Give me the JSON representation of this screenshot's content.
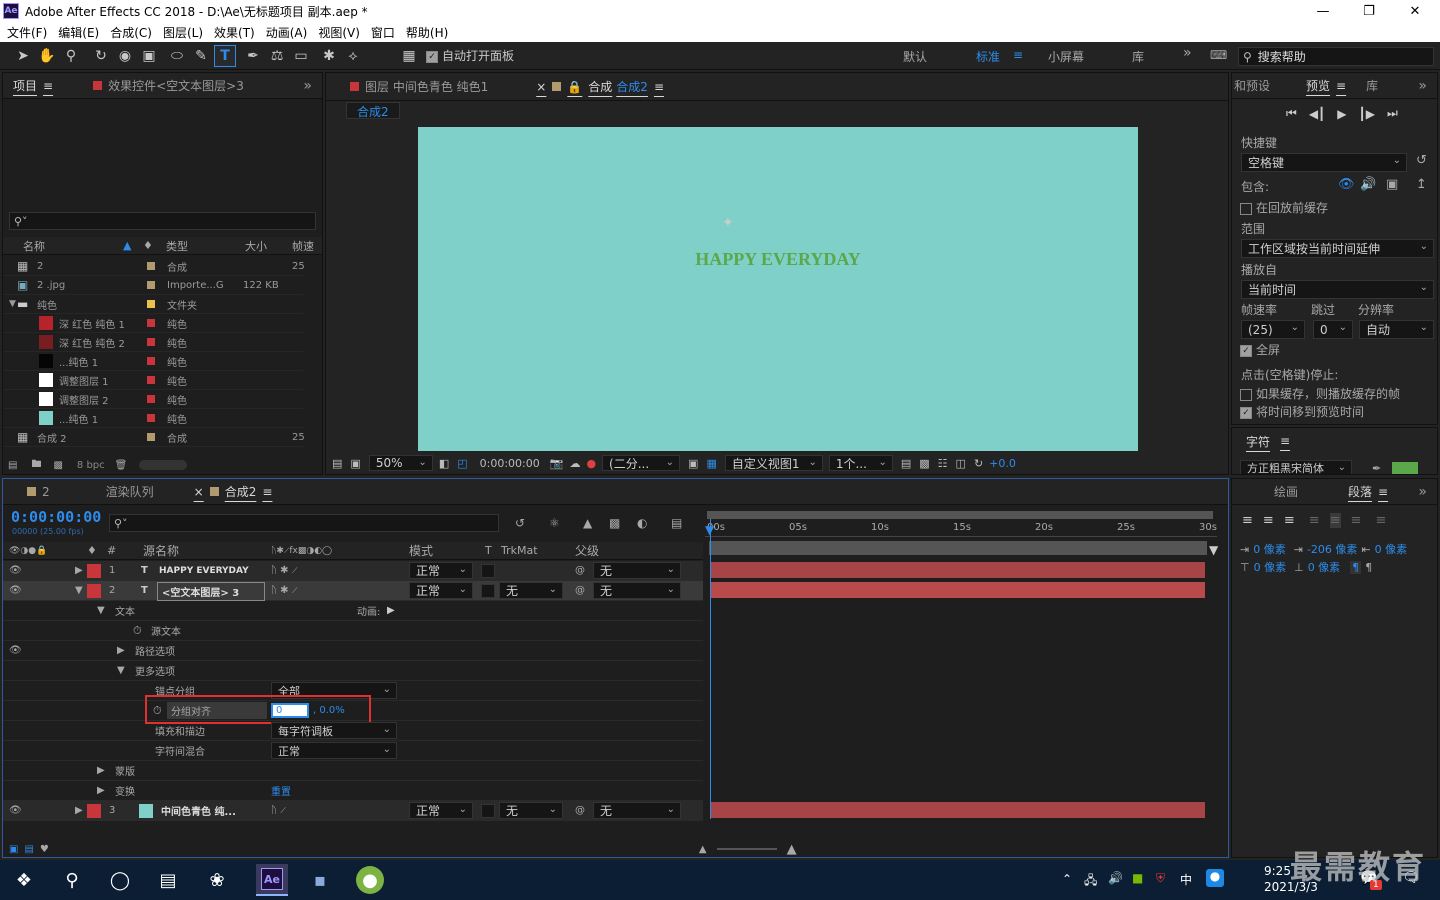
{
  "titlebar": {
    "title": "Adobe After Effects CC 2018 - D:\\Ae\\无标题项目 副本.aep *"
  },
  "menu": [
    "文件(F)",
    "编辑(E)",
    "合成(C)",
    "图层(L)",
    "效果(T)",
    "动画(A)",
    "视图(V)",
    "窗口",
    "帮助(H)"
  ],
  "toolbar": {
    "auto_open_label": "自动打开面板",
    "workspaces": [
      "默认",
      "标准",
      "小屏幕",
      "库"
    ],
    "active_workspace": "标准",
    "search_placeholder": "搜索帮助"
  },
  "project": {
    "tab_project": "项目",
    "tab_effects": "效果控件<空文本图层>3",
    "columns": {
      "name": "名称",
      "type": "类型",
      "size": "大小",
      "fps": "帧速"
    },
    "items": [
      {
        "name": "2",
        "type": "合成",
        "size": "",
        "fps": "25",
        "label_color": "#b09a6e",
        "swatch": "comp"
      },
      {
        "name": "2 .jpg",
        "type": "Importe...G",
        "size": "122 KB",
        "fps": "",
        "label_color": "#b09a6e",
        "swatch": "file"
      },
      {
        "name": "纯色",
        "type": "文件夹",
        "size": "",
        "fps": "",
        "label_color": "#e8c24a",
        "swatch": "folder"
      },
      {
        "name": "深 红色 纯色 1",
        "type": "纯色",
        "size": "",
        "fps": "",
        "label_color": "#c8363c",
        "swatch": "#b5232b"
      },
      {
        "name": "深 红色 纯色 2",
        "type": "纯色",
        "size": "",
        "fps": "",
        "label_color": "#c8363c",
        "swatch": "#7a1d22"
      },
      {
        "name": "...纯色 1",
        "type": "纯色",
        "size": "",
        "fps": "",
        "label_color": "#c8363c",
        "swatch": "#050505"
      },
      {
        "name": "调整图层 1",
        "type": "纯色",
        "size": "",
        "fps": "",
        "label_color": "#c8363c",
        "swatch": "#ffffff"
      },
      {
        "name": "调整图层 2",
        "type": "纯色",
        "size": "",
        "fps": "",
        "label_color": "#c8363c",
        "swatch": "#ffffff"
      },
      {
        "name": "...纯色 1",
        "type": "纯色",
        "size": "",
        "fps": "",
        "label_color": "#c8363c",
        "swatch": "#7ed0c8"
      },
      {
        "name": "合成 2",
        "type": "合成",
        "size": "",
        "fps": "25",
        "label_color": "#b09a6e",
        "swatch": "comp"
      }
    ],
    "bpc": "8 bpc"
  },
  "viewer": {
    "tab_layer": "图层 中间色青色 纯色1",
    "tab_comp": "合成",
    "tab_comp_name": "合成2",
    "breadcrumb": "合成2",
    "canvas_color": "#7ed0c8",
    "canvas_text": "HAPPY EVERYDAY",
    "canvas_text_color": "#5aa84a",
    "zoom": "50%",
    "timecode": "0:00:00:00",
    "resolution": "(二分...",
    "view": "自定义视图1",
    "views_count": "1个...",
    "exposure": "+0.0"
  },
  "preview": {
    "tab_presets": "和预设",
    "tab_preview": "预览",
    "tab_library": "库",
    "shortcut_label": "快捷键",
    "shortcut_value": "空格键",
    "include_label": "包含:",
    "cache_before": "在回放前缓存",
    "range_label": "范围",
    "range_value": "工作区域按当前时间延伸",
    "play_from_label": "播放自",
    "play_from_value": "当前时间",
    "fps_label": "帧速率",
    "skip_label": "跳过",
    "res_label": "分辨率",
    "fps_value": "(25)",
    "skip_value": "0",
    "res_value": "自动",
    "fullscreen": "全屏",
    "stop_label": "点击(空格键)停止:",
    "stop_opt1": "如果缓存，则播放缓存的帧",
    "stop_opt2": "将时间移到预览时间",
    "character_tab": "字符",
    "font_value": "方正粗黑宋简体"
  },
  "paragraph": {
    "tab_draw": "绘画",
    "tab_paragraph": "段落",
    "indent_left": "0 像素",
    "indent_first": "-206 像素",
    "indent_right": "0 像素",
    "space_before": "0 像素",
    "space_after": "0 像素"
  },
  "timeline": {
    "tab_2": "2",
    "tab_render": "渲染队列",
    "tab_comp": "合成2",
    "timecode": "0:00:00:00",
    "timecode_sub": "00000 (25.00 fps)",
    "columns": {
      "source": "源名称",
      "mode": "模式",
      "t": "T",
      "trkmat": "TrkMat",
      "parent": "父级"
    },
    "ruler": [
      "00s",
      "05s",
      "10s",
      "15s",
      "20s",
      "25s",
      "30s"
    ],
    "layers": [
      {
        "num": "1",
        "type": "T",
        "name": "HAPPY EVERYDAY",
        "mode": "正常",
        "trkmat": "",
        "parent": "无"
      },
      {
        "num": "2",
        "type": "T",
        "name": "<空文本图层> 3",
        "mode": "正常",
        "trkmat": "无",
        "parent": "无"
      },
      {
        "num": "3",
        "type": "",
        "name": "中间色青色 纯...",
        "mode": "正常",
        "trkmat": "无",
        "parent": "无"
      }
    ],
    "props": {
      "text": "文本",
      "animate": "动画:",
      "source_text": "源文本",
      "path_options": "路径选项",
      "more_options": "更多选项",
      "anchor_group": "锚点分组",
      "anchor_group_value": "全部",
      "group_align": "分组对齐",
      "group_align_x": "0",
      "group_align_y": ", 0.0%",
      "fill_stroke": "填充和描边",
      "fill_stroke_value": "每字符调板",
      "blend": "字符间混合",
      "blend_value": "正常",
      "masks": "蒙版",
      "transform": "变换",
      "reset": "重置"
    }
  },
  "taskbar": {
    "time": "9:25",
    "date": "2021/3/3",
    "ime": "中",
    "notifications": "1",
    "watermark": "最需教育"
  }
}
